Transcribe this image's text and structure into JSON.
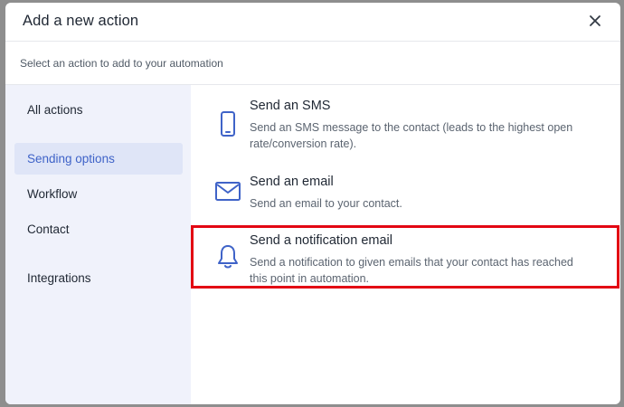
{
  "dialog": {
    "title": "Add a new action",
    "subtitle": "Select an action to add to your automation",
    "close_icon": "close-icon"
  },
  "sidebar": {
    "items": [
      {
        "label": "All actions",
        "active": false
      },
      {
        "label": "Sending options",
        "active": true
      },
      {
        "label": "Workflow",
        "active": false
      },
      {
        "label": "Contact",
        "active": false
      },
      {
        "label": "Integrations",
        "active": false
      }
    ]
  },
  "options": [
    {
      "icon": "mobile-phone-icon",
      "title": "Send an SMS",
      "description": "Send an SMS message to the contact (leads to the highest open rate/conversion rate)."
    },
    {
      "icon": "envelope-icon",
      "title": "Send an email",
      "description": "Send an email to your contact."
    },
    {
      "icon": "bell-icon",
      "title": "Send a notification email",
      "description": "Send a notification to given emails that your contact has reached this point in automation.",
      "highlighted": true
    }
  ],
  "colors": {
    "accent": "#3f63c8",
    "highlight_border": "#e30613",
    "sidebar_bg": "#f0f2fb",
    "active_item_bg": "#dfe5f7"
  }
}
